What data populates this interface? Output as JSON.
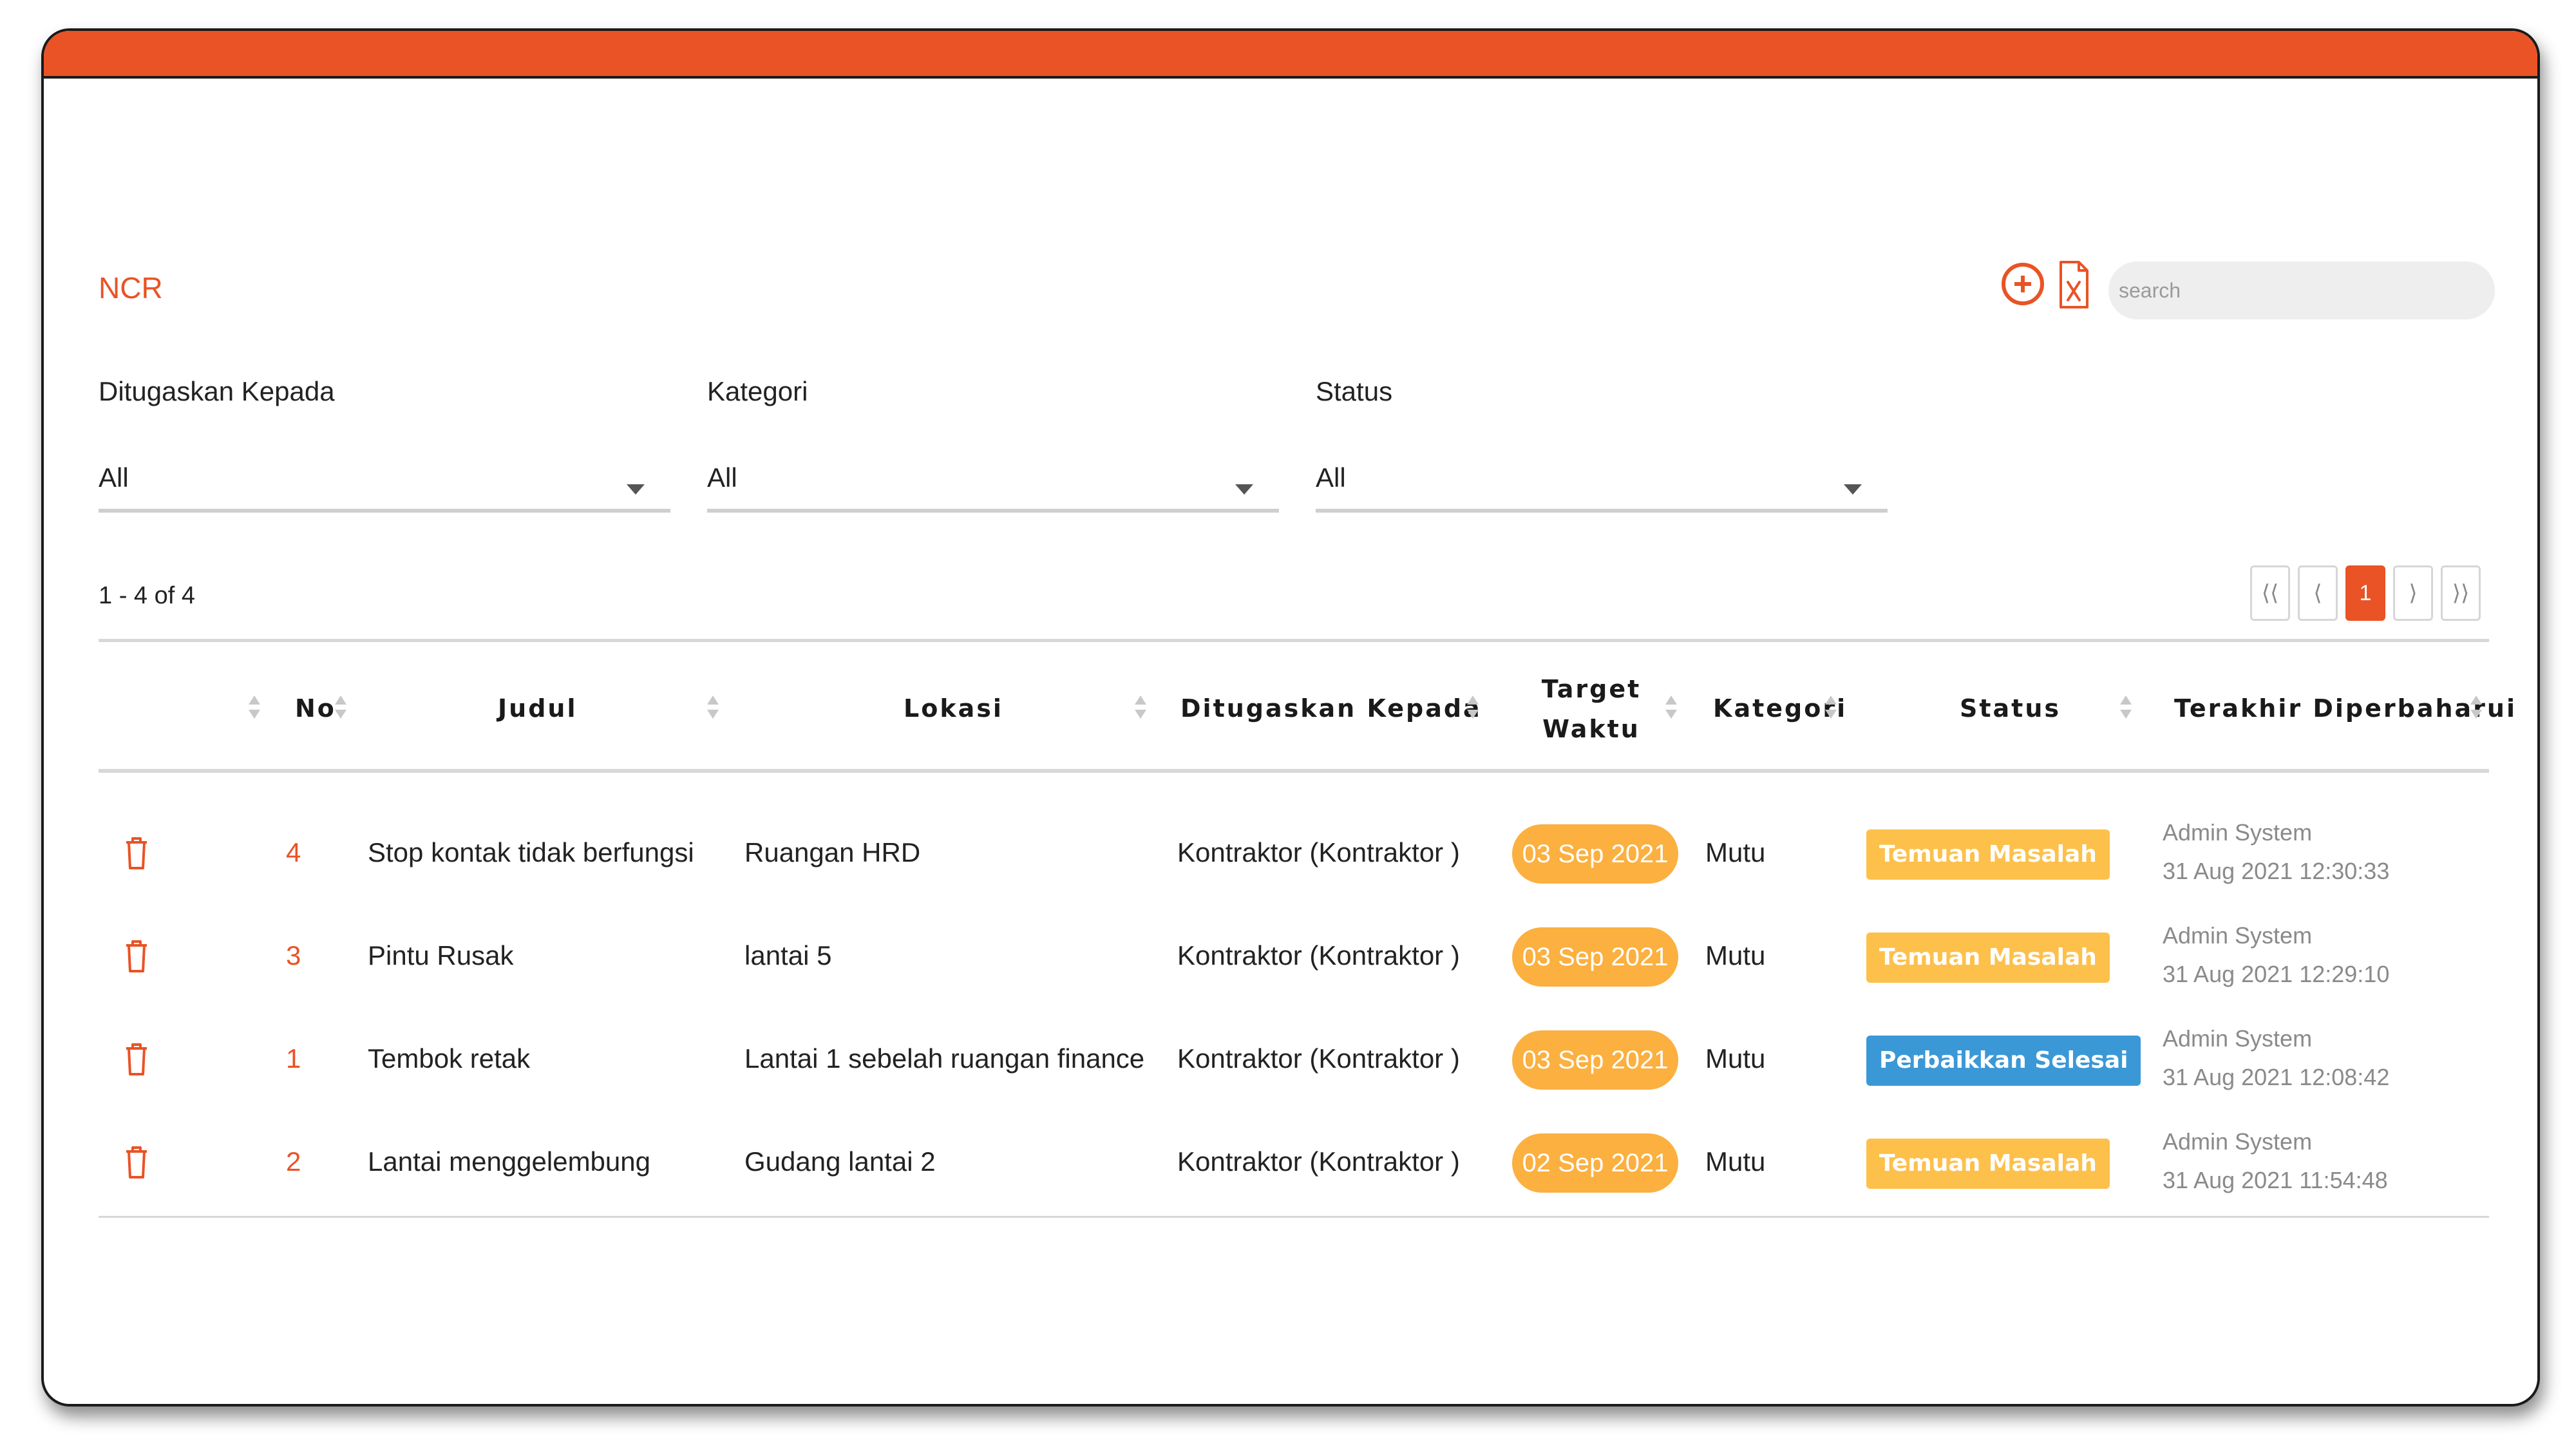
{
  "page": {
    "title": "NCR"
  },
  "toolbar": {
    "add_icon": "add-circle-icon",
    "excel_icon": "excel-export-icon",
    "search_placeholder": "search"
  },
  "filters": [
    {
      "label": "Ditugaskan Kepada",
      "value": "All"
    },
    {
      "label": "Kategori",
      "value": "All"
    },
    {
      "label": "Status",
      "value": "All"
    }
  ],
  "pagination": {
    "range_text": "1 - 4 of 4",
    "first": "⟨⟨",
    "prev": "⟨",
    "current": "1",
    "next": "⟩",
    "last": "⟩⟩"
  },
  "table": {
    "headers": {
      "no": "No",
      "judul": "Judul",
      "lokasi": "Lokasi",
      "ditugaskan": "Ditugaskan Kepada",
      "target_1": "Target",
      "target_2": "Waktu",
      "kategori": "Kategori",
      "status": "Status",
      "terakhir": "Terakhir Diperbaharui"
    },
    "rows": [
      {
        "no": "4",
        "judul": "Stop kontak tidak berfungsi",
        "lokasi": "Ruangan HRD",
        "ditugaskan": "Kontraktor (Kontraktor )",
        "target": "03 Sep 2021",
        "kategori": "Mutu",
        "status": "Temuan Masalah",
        "status_type": "warn",
        "updated_by": "Admin System",
        "updated_at": "31 Aug 2021 12:30:33"
      },
      {
        "no": "3",
        "judul": "Pintu Rusak",
        "lokasi": "lantai 5",
        "ditugaskan": "Kontraktor (Kontraktor )",
        "target": "03 Sep 2021",
        "kategori": "Mutu",
        "status": "Temuan Masalah",
        "status_type": "warn",
        "updated_by": "Admin System",
        "updated_at": "31 Aug 2021 12:29:10"
      },
      {
        "no": "1",
        "judul": "Tembok retak",
        "lokasi": "Lantai 1 sebelah ruangan finance",
        "ditugaskan": "Kontraktor (Kontraktor )",
        "target": "03 Sep 2021",
        "kategori": "Mutu",
        "status": "Perbaikkan Selesai",
        "status_type": "done",
        "updated_by": "Admin System",
        "updated_at": "31 Aug 2021 12:08:42"
      },
      {
        "no": "2",
        "judul": "Lantai menggelembung",
        "lokasi": "Gudang lantai 2",
        "ditugaskan": "Kontraktor (Kontraktor )",
        "target": "02 Sep 2021",
        "kategori": "Mutu",
        "status": "Temuan Masalah",
        "status_type": "warn",
        "updated_by": "Admin System",
        "updated_at": "31 Aug 2021 11:54:48"
      }
    ]
  },
  "colors": {
    "brand": "#e95325",
    "pill": "#fbb040",
    "status_warn": "#fdc04a",
    "status_done": "#3b98d6"
  }
}
